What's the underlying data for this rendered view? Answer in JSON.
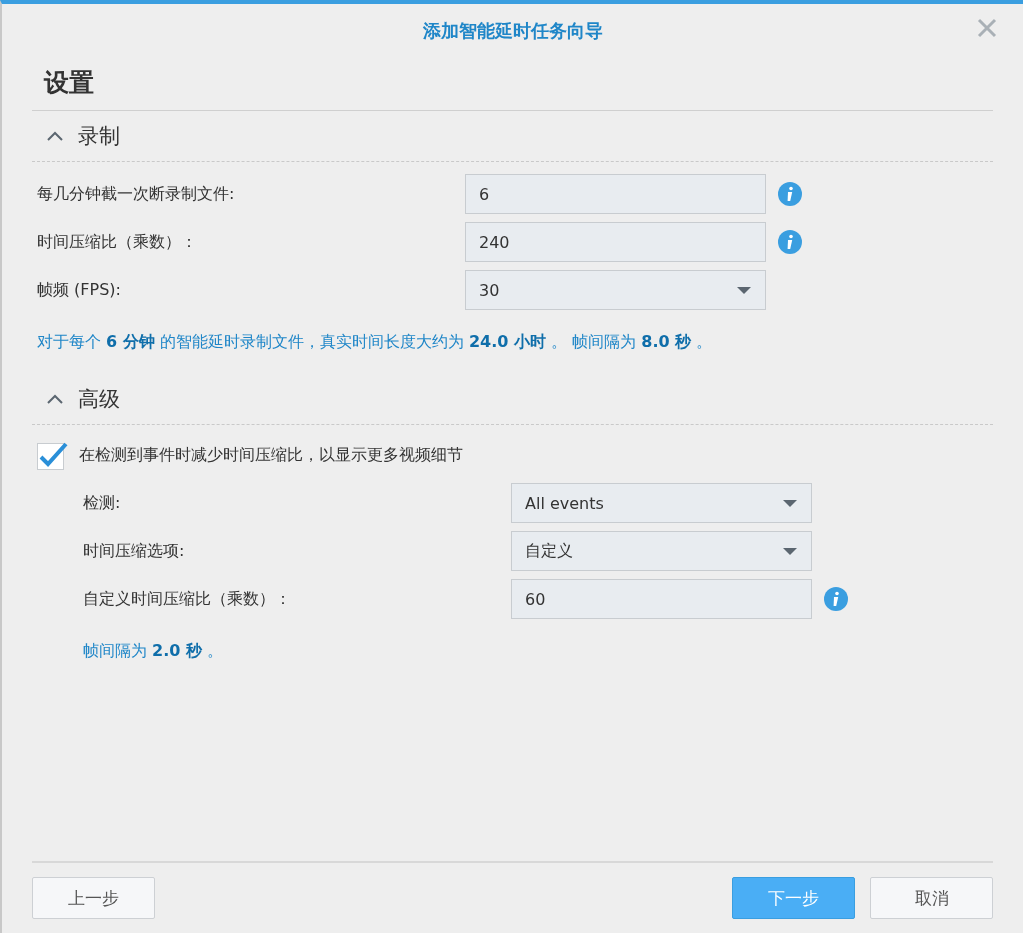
{
  "window": {
    "title": "添加智能延时任务向导"
  },
  "page_title": "设置",
  "sections": [
    {
      "title": "录制",
      "expanded": true,
      "rows": [
        {
          "kind": "text",
          "label": "每几分钟截一次断录制文件:",
          "value": "6",
          "info": true
        },
        {
          "kind": "text",
          "label": "时间压缩比（乘数）：",
          "value": "240",
          "info": true
        },
        {
          "kind": "select",
          "label": "帧频 (FPS):",
          "value": "30",
          "info": false
        }
      ],
      "note": "对于每个 **6 分钟** 的智能延时录制文件，真实时间长度大约为 **24.0 小时** 。 帧间隔为 **8.0 秒** 。"
    },
    {
      "title": "高级",
      "expanded": true,
      "checkbox": {
        "label": "在检测到事件时减少时间压缩比，以显示更多视频细节",
        "checked": true
      },
      "rows": [
        {
          "kind": "select",
          "label": "检测:",
          "value": "All events",
          "info": false
        },
        {
          "kind": "select",
          "label": "时间压缩选项:",
          "value": "自定义",
          "info": false
        },
        {
          "kind": "text",
          "label": "自定义时间压缩比（乘数）：",
          "value": "60",
          "info": true
        }
      ],
      "note": "帧间隔为 **2.0 秒** 。"
    }
  ],
  "buttons": [
    {
      "label": "上一步",
      "kind": "default"
    },
    {
      "label": "下一步",
      "kind": "primary"
    },
    {
      "label": "取消",
      "kind": "default"
    }
  ]
}
